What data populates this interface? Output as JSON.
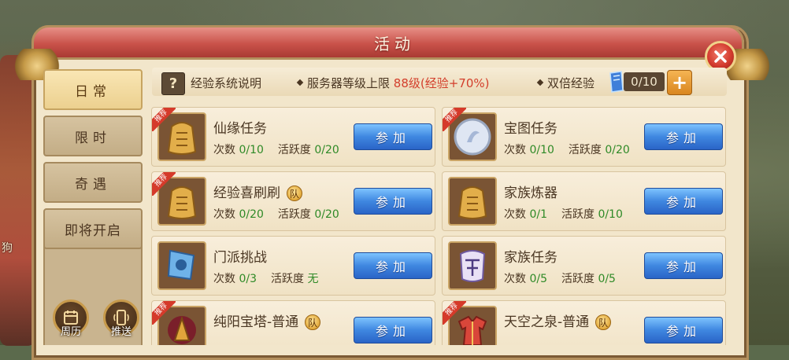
{
  "window": {
    "title": "活动"
  },
  "scene": {
    "side_text": "狗"
  },
  "tabs": [
    {
      "label": "日常",
      "active": true
    },
    {
      "label": "限时",
      "active": false
    },
    {
      "label": "奇遇",
      "active": false
    },
    {
      "label": "即将开启",
      "active": false
    }
  ],
  "bottom_buttons": [
    {
      "label": "周历",
      "icon": "calendar-icon"
    },
    {
      "label": "推送",
      "icon": "phone-icon"
    }
  ],
  "info": {
    "help_symbol": "?",
    "help_label": "经验系统说明",
    "server_cap_label": "服务器等级上限",
    "server_cap_value": "88级(经验+70%)",
    "double_exp_label": "双倍经验",
    "double_exp_count": "0/10",
    "plus_symbol": "+"
  },
  "labels": {
    "count": "次数",
    "activity": "活跃度",
    "join": "参加",
    "team": "队",
    "recommended": "推荐"
  },
  "activities": [
    {
      "name": "仙缘任务",
      "icon": "exp-token-icon",
      "count": "0/10",
      "activity": "0/20",
      "recommended": true,
      "team": false
    },
    {
      "name": "宝图任务",
      "icon": "silver-plate-icon",
      "count": "0/10",
      "activity": "0/20",
      "recommended": true,
      "team": false
    },
    {
      "name": "经验喜刷刷",
      "icon": "exp-token-icon",
      "count": "0/20",
      "activity": "0/20",
      "recommended": true,
      "team": true
    },
    {
      "name": "家族炼器",
      "icon": "exp-token-icon",
      "count": "0/1",
      "activity": "0/10",
      "recommended": false,
      "team": false
    },
    {
      "name": "门派挑战",
      "icon": "blue-flag-icon",
      "count": "0/3",
      "activity": "无",
      "recommended": false,
      "team": false
    },
    {
      "name": "家族任务",
      "icon": "family-token-icon",
      "count": "0/5",
      "activity": "0/5",
      "recommended": false,
      "team": false
    },
    {
      "name": "纯阳宝塔-普通",
      "icon": "tower-icon",
      "count": "",
      "activity": "",
      "recommended": true,
      "team": true
    },
    {
      "name": "天空之泉-普通",
      "icon": "robe-icon",
      "count": "",
      "activity": "",
      "recommended": true,
      "team": true
    }
  ],
  "colors": {
    "accent_red": "#d33e2b",
    "value_green": "#2f8a27",
    "button_blue": "#3f87e0"
  }
}
